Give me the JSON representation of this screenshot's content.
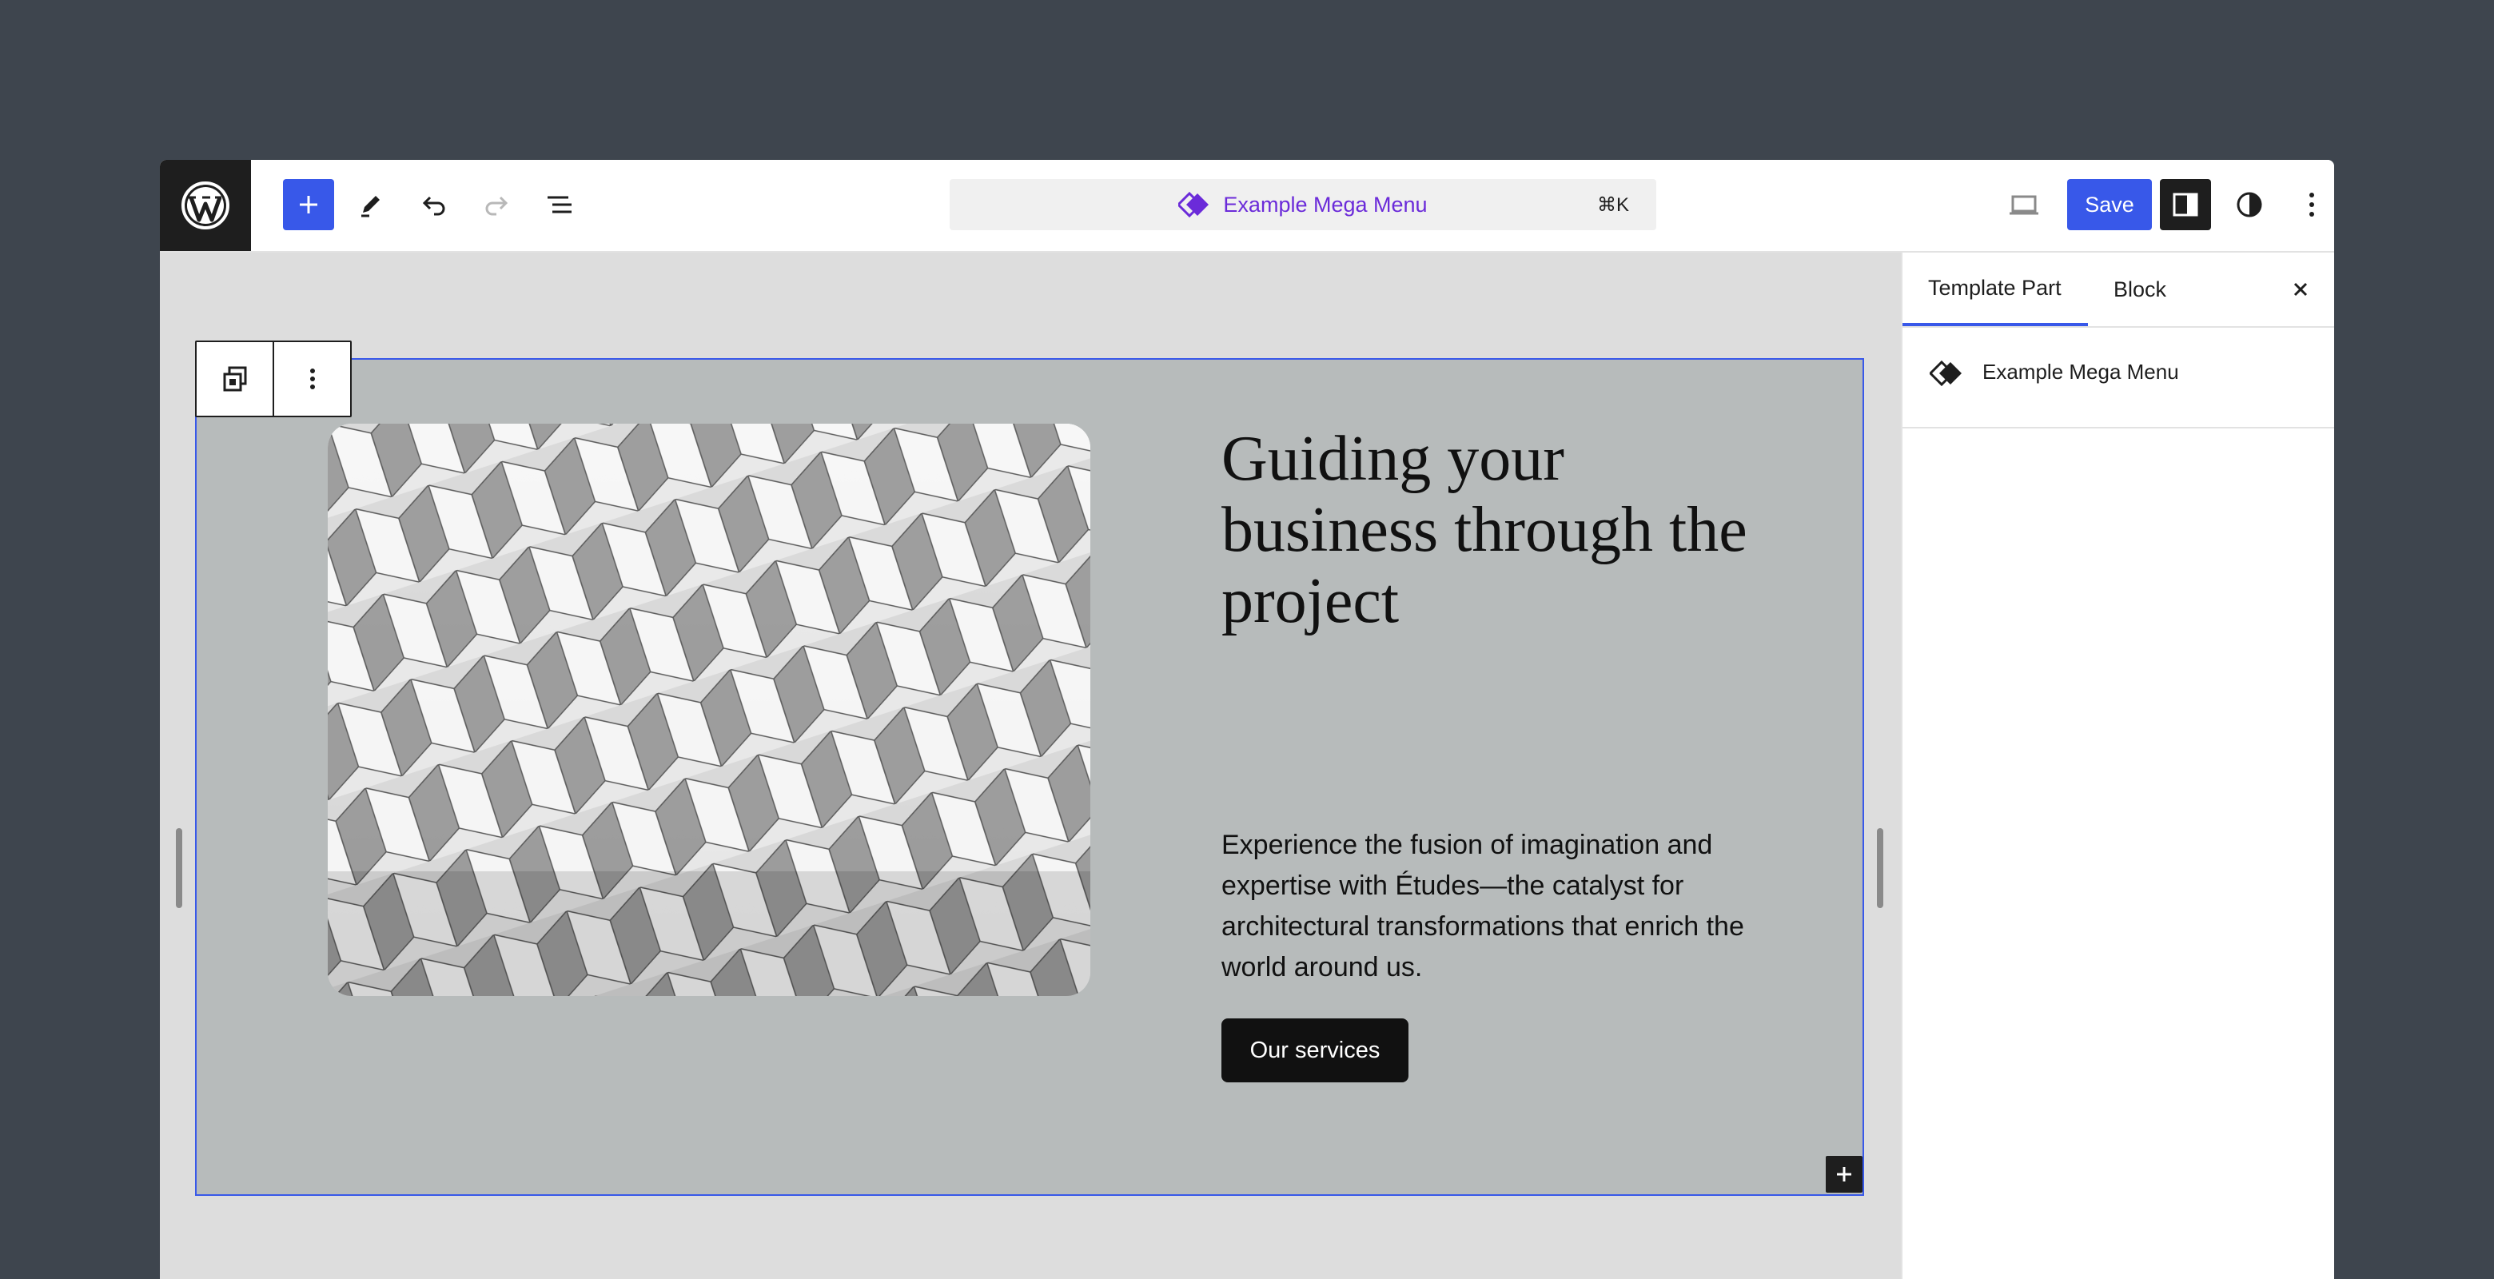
{
  "toolbar": {
    "command_title": "Example Mega Menu",
    "command_shortcut": "⌘K",
    "save_label": "Save"
  },
  "icons": {
    "logo": "wordpress-logo",
    "add": "plus-icon",
    "edit": "pencil-icon",
    "undo": "undo-icon",
    "redo": "redo-icon",
    "list_view": "list-view-icon",
    "template_part": "diamond-icon",
    "device_preview": "laptop-icon",
    "settings": "sidebar-toggle-icon",
    "styles": "half-circle-icon",
    "options": "vertical-ellipsis-icon",
    "close": "close-icon"
  },
  "colors": {
    "accent": "#3858e9",
    "template_part": "#6b2bd9",
    "dark": "#1e1e1e",
    "block_background": "#b7bbbb"
  },
  "hero": {
    "heading": "Guiding your business through the project",
    "body": "Experience the fusion of imagination and expertise with Études—the catalyst for architectural transformations that enrich the world around us.",
    "button": "Our services"
  },
  "sidebar": {
    "tabs": [
      {
        "label": "Template Part"
      },
      {
        "label": "Block"
      }
    ],
    "active_tab": "Template Part",
    "card_title": "Example Mega Menu"
  }
}
